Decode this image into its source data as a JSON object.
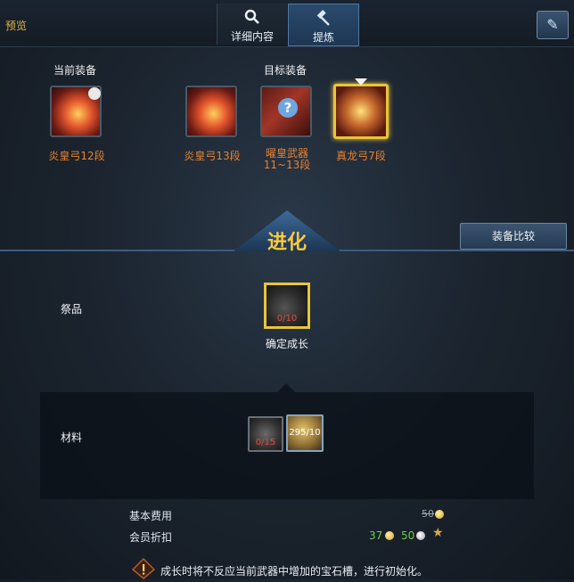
{
  "topbar": {
    "preview_label": "预览",
    "tabs": [
      {
        "label": "详细内容",
        "icon": "magnifier-icon"
      },
      {
        "label": "提炼",
        "icon": "hammer-icon"
      }
    ]
  },
  "current_equipment": {
    "title": "当前装备",
    "item": {
      "name": "炎皇弓12段"
    }
  },
  "target_equipment": {
    "title": "目标装备",
    "items": [
      {
        "name": "炎皇弓13段"
      },
      {
        "name": "曜皇武器11~13段"
      },
      {
        "name": "真龙弓7段"
      }
    ]
  },
  "compare_button": "装备比较",
  "evolve_title": "进化",
  "sacrifice": {
    "label": "祭品",
    "count": "0/10",
    "caption": "确定成长"
  },
  "materials": {
    "label": "材料",
    "items": [
      {
        "count": "0/15"
      },
      {
        "count": "295/10"
      }
    ]
  },
  "fees": {
    "base_label": "基本费用",
    "base_value": "50",
    "member_label": "会员折扣",
    "member_gold": "37",
    "member_silver": "50"
  },
  "warning": "成长时将不反应当前武器中增加的宝石槽，进行初始化。",
  "colors": {
    "accent_gold": "#e7c53b",
    "item_name_orange": "#e9812b",
    "count_red": "#e24a3a",
    "green_value": "#6bd04a"
  }
}
